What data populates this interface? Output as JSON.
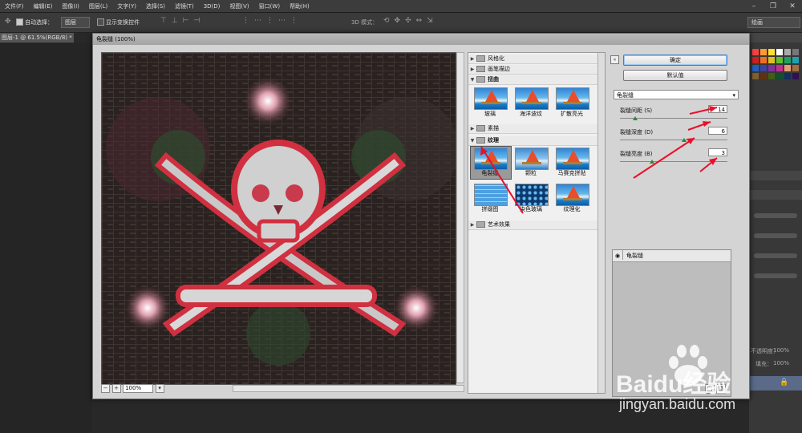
{
  "menu": {
    "items": [
      "文件(F)",
      "编辑(E)",
      "图像(I)",
      "图层(L)",
      "文字(Y)",
      "选择(S)",
      "滤镜(T)",
      "3D(D)",
      "视图(V)",
      "窗口(W)",
      "帮助(H)"
    ]
  },
  "options_bar": {
    "auto_select_label": "自动选择：",
    "auto_select_value": "图层",
    "show_transform_label": "显示变换控件",
    "mode_3d_label": "3D 模式：",
    "workspace_value": "绘画"
  },
  "document": {
    "tab_label": "图层-1 @ 61.5%(RGB/8) *"
  },
  "dialog": {
    "title": "龟裂缝 (100%)",
    "zoom": "100%",
    "zoom_out": "−",
    "zoom_in": "+",
    "gallery": {
      "categories": [
        {
          "label": "风格化",
          "open": false
        },
        {
          "label": "画笔描边",
          "open": false
        },
        {
          "label": "扭曲",
          "open": true,
          "items": [
            "玻璃",
            "海洋波纹",
            "扩散亮光"
          ]
        },
        {
          "label": "素描",
          "open": false
        },
        {
          "label": "纹理",
          "open": true,
          "items": [
            "龟裂缝",
            "颗粒",
            "马赛克拼贴",
            "拼缀图",
            "染色玻璃",
            "纹理化"
          ],
          "selected": "龟裂缝"
        },
        {
          "label": "艺术效果",
          "open": false
        }
      ]
    },
    "settings": {
      "ok": "确定",
      "default": "默认值",
      "filter_selected": "龟裂缝",
      "params": [
        {
          "label": "裂缝间距 (S)",
          "value": "14",
          "fraction": 0.14
        },
        {
          "label": "裂缝深度 (D)",
          "value": "6",
          "fraction": 0.6
        },
        {
          "label": "裂缝亮度 (B)",
          "value": "3",
          "fraction": 0.3
        }
      ]
    },
    "applied_layer": "龟裂缝"
  },
  "right_panel": {
    "opacity_label": "不透明度：",
    "opacity_value": "100%",
    "fill_label": "填充：",
    "fill_value": "100%"
  },
  "watermark": {
    "logo": "Baidu经验",
    "url": "jingyan.baidu.com"
  },
  "colors": {
    "arrow": "#e8102a",
    "accent": "#3b7fd0"
  }
}
